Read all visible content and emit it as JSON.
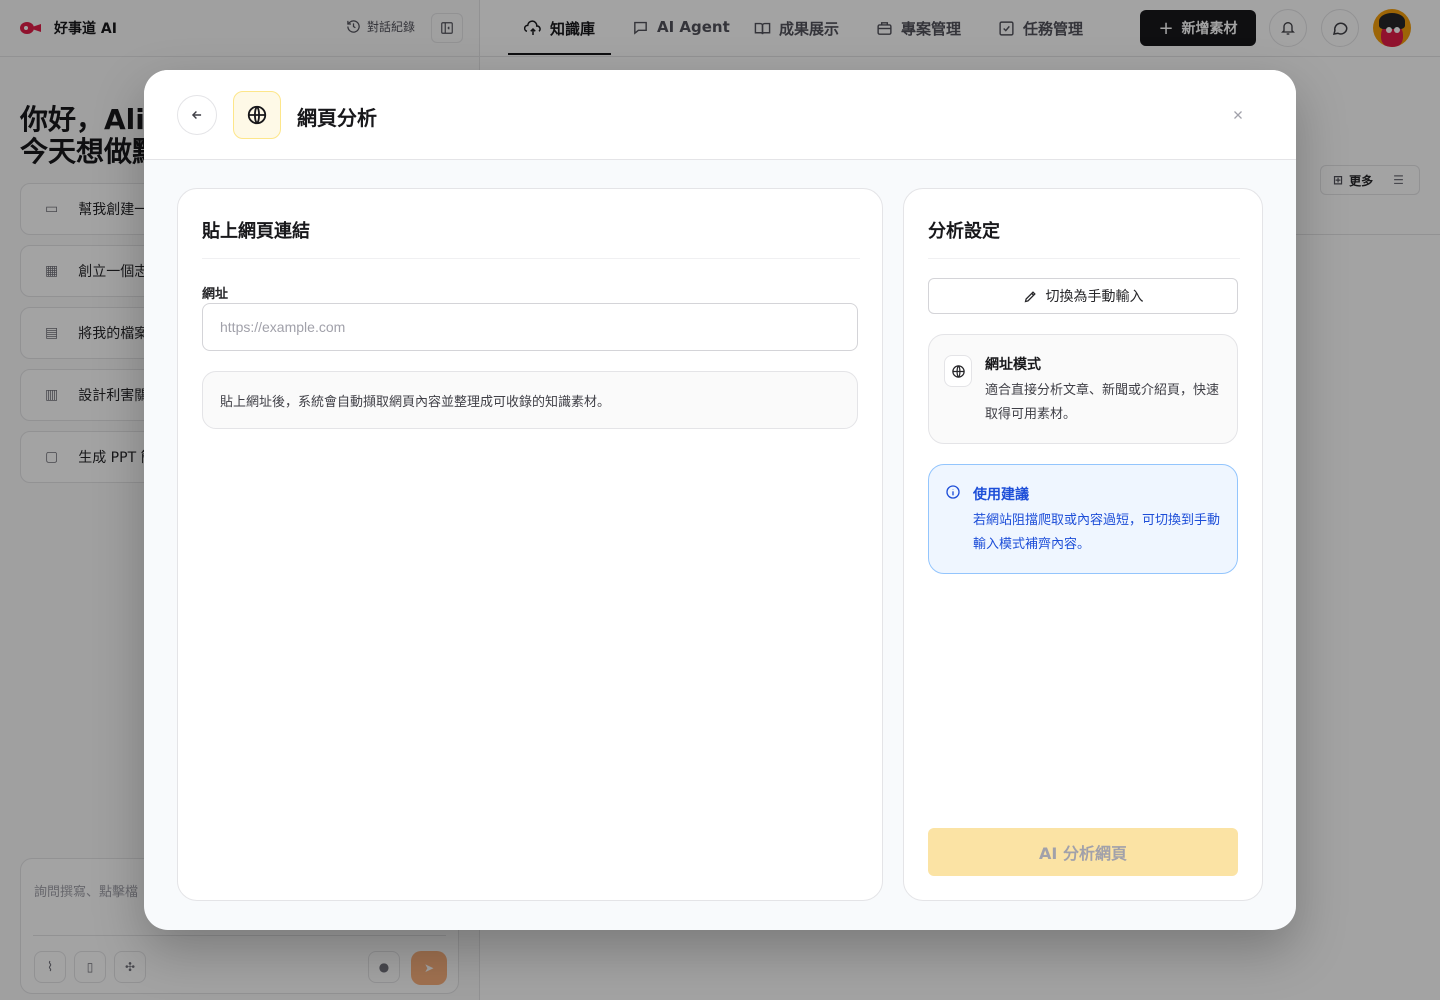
{
  "app": {
    "brand": "好事道 AI",
    "history_label": "對話紀錄",
    "greeting_line1": "你好，Alic",
    "greeting_line2": "今天想做點",
    "suggestions": [
      "幫我創建一",
      "創立一個志",
      "將我的檔案",
      "設計利害關",
      "生成 PPT 簡"
    ],
    "chat_placeholder": "詢問撰寫、點擊檔"
  },
  "nav": {
    "items": [
      {
        "label": "知識庫",
        "icon": "cloud-upload-icon"
      },
      {
        "label": "AI Agent",
        "icon": "chat-bot-icon"
      },
      {
        "label": "成果展示",
        "icon": "book-icon"
      },
      {
        "label": "專案管理",
        "icon": "briefcase-icon"
      },
      {
        "label": "任務管理",
        "icon": "checkbox-icon"
      }
    ],
    "new_button": "新增素材",
    "more_label": "更多"
  },
  "modal": {
    "title": "網頁分析",
    "left_card": {
      "title": "貼上網頁連結",
      "url_label": "網址",
      "url_placeholder": "https://example.com",
      "url_value": "",
      "hint": "貼上網址後，系統會自動擷取網頁內容並整理成可收錄的知識素材。"
    },
    "right_card": {
      "title": "分析設定",
      "switch_button": "切換為手動輸入",
      "mode_title": "網址模式",
      "mode_desc": "適合直接分析文章、新聞或介紹頁，快速取得可用素材。",
      "tip_title": "使用建議",
      "tip_desc": "若網站阻擋爬取或內容過短，可切換到手動輸入模式補齊內容。",
      "analyze_button": "AI 分析網頁"
    }
  },
  "colors": {
    "accent": "#18181b",
    "brand_red": "#e11d48",
    "tip_blue": "#1d4ed8",
    "analyze_disabled": "#fbe3a4"
  }
}
